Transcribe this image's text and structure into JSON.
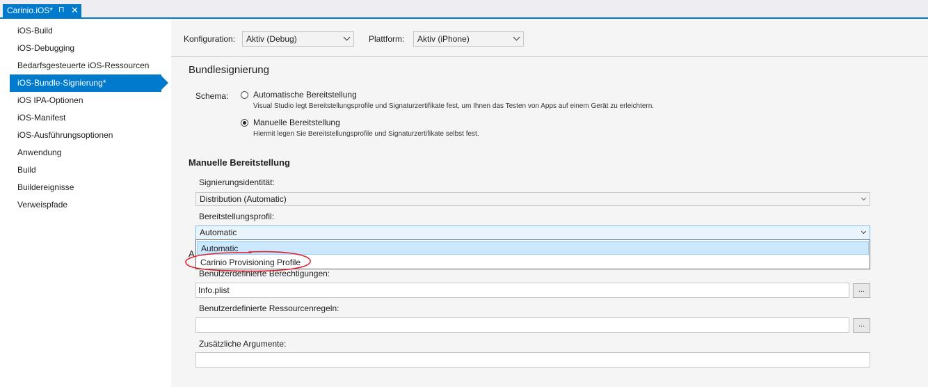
{
  "tab": {
    "title": "Carinio.iOS*",
    "pin_glyph": "⊓",
    "close_glyph": "✕"
  },
  "sidebar": {
    "items": [
      {
        "label": "iOS-Build"
      },
      {
        "label": "iOS-Debugging"
      },
      {
        "label": "Bedarfsgesteuerte iOS-Ressourcen"
      },
      {
        "label": "iOS-Bundle-Signierung*"
      },
      {
        "label": "iOS IPA-Optionen"
      },
      {
        "label": "iOS-Manifest"
      },
      {
        "label": "iOS-Ausführungsoptionen"
      },
      {
        "label": "Anwendung"
      },
      {
        "label": "Build"
      },
      {
        "label": "Buildereignisse"
      },
      {
        "label": "Verweispfade"
      }
    ],
    "selected": "iOS-Bundle-Signierung*"
  },
  "toolbar": {
    "config_label": "Konfiguration:",
    "config_value": "Aktiv (Debug)",
    "platform_label": "Plattform:",
    "platform_value": "Aktiv (iPhone)"
  },
  "section": {
    "title": "Bundlesignierung",
    "schema_label": "Schema:",
    "auto_title": "Automatische Bereitstellung",
    "auto_desc": "Visual Studio legt Bereitstellungsprofile und Signaturzertifikate fest, um Ihnen das Testen von Apps auf einem Gerät zu erleichtern.",
    "manual_title": "Manuelle Bereitstellung",
    "manual_desc": "Hiermit legen Sie Bereitstellungsprofile und Signaturzertifikate selbst fest."
  },
  "manual": {
    "title": "Manuelle Bereitstellung",
    "identity_label": "Signierungsidentität:",
    "identity_value": "Distribution (Automatic)",
    "profile_label": "Bereitstellungsprofil:",
    "profile_value": "Automatic",
    "profile_options": [
      "Automatic",
      "Carinio Provisioning Profile"
    ],
    "hidden_label_fragment": "A",
    "entitlements_label": "Benutzerdefinierte Berechtigungen:",
    "entitlements_value": "Info.plist",
    "resource_rules_label": "Benutzerdefinierte Ressourcenregeln:",
    "resource_rules_value": "",
    "extra_args_label": "Zusätzliche Argumente:",
    "extra_args_value": "",
    "browse_label": "..."
  },
  "colors": {
    "accent": "#007acc",
    "annotation": "#e0202a",
    "highlight": "#cce8ff"
  }
}
